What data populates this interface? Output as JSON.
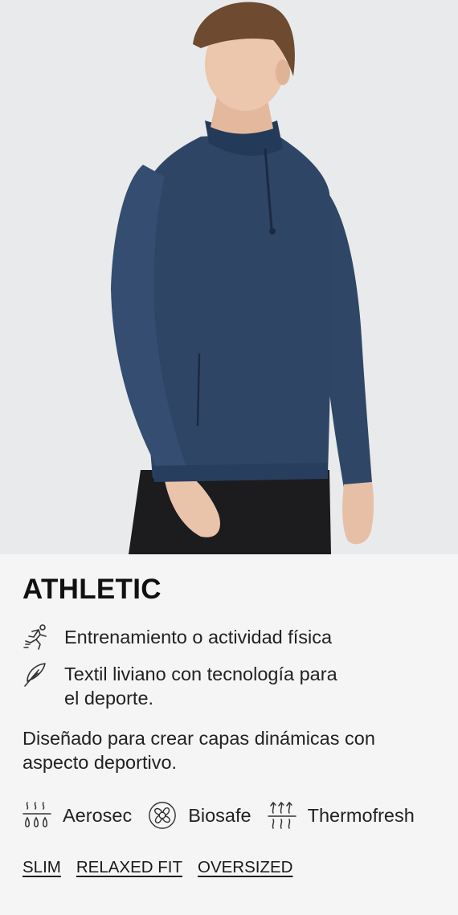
{
  "product": {
    "title": "ATHLETIC",
    "features": [
      {
        "icon": "running-person-icon",
        "text": "Entrenamiento o actividad física"
      },
      {
        "icon": "feather-icon",
        "text": "Textil liviano con tecnología para el deporte."
      }
    ],
    "description": "Diseñado para crear capas dinámicas con aspecto deportivo.",
    "technologies": [
      {
        "icon": "sweat-drops-icon",
        "label": "Aerosec"
      },
      {
        "icon": "biosafe-molecule-icon",
        "label": "Biosafe"
      },
      {
        "icon": "heat-waves-icon",
        "label": "Thermofresh"
      }
    ],
    "fits": [
      "SLIM",
      "RELAXED FIT",
      "OVERSIZED"
    ]
  },
  "colors": {
    "hero_bg": "#e9eaeb",
    "garment": "#2e4566",
    "panel_bg": "#f5f5f5",
    "text": "#1f1f1f"
  }
}
